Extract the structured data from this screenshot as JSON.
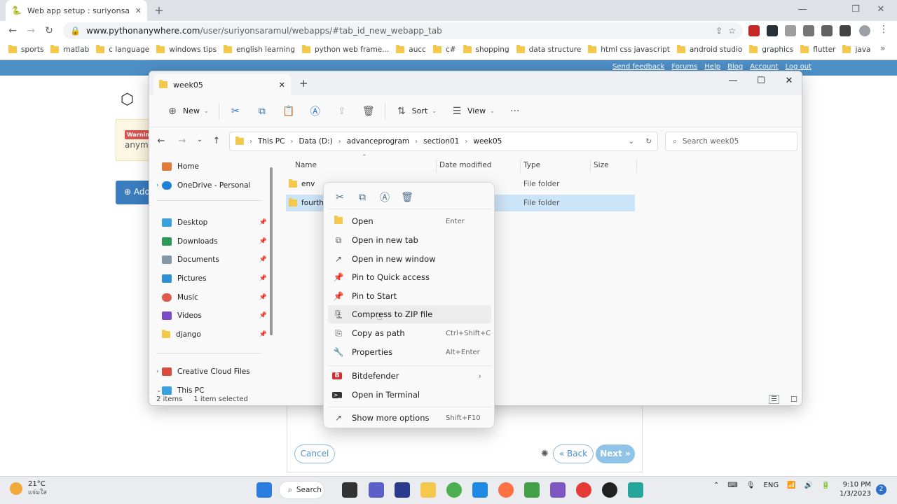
{
  "browser": {
    "tab_title": "Web app setup : suriyonsaramul",
    "url_host": "www.pythonanywhere.com",
    "url_path": "/user/suriyonsaramul/webapps/#tab_id_new_webapp_tab",
    "bookmarks": [
      "sports",
      "matlab",
      "c language",
      "windows tips",
      "english learning",
      "python web frame...",
      "aucc",
      "c#",
      "shopping",
      "data structure",
      "html css javascript",
      "android studio",
      "graphics",
      "flutter",
      "java"
    ]
  },
  "page": {
    "links": [
      "Send feedback",
      "Forums",
      "Help",
      "Blog",
      "Account",
      "Log out"
    ],
    "warning_badge": "Warnin",
    "warning_text": "anymo",
    "add_label": "Add",
    "cancel": "Cancel",
    "back": "« Back",
    "next": "Next »"
  },
  "explorer": {
    "tab_title": "week05",
    "commands": {
      "new": "New",
      "sort": "Sort",
      "view": "View"
    },
    "breadcrumb": [
      "This PC",
      "Data (D:)",
      "advanceprogram",
      "section01",
      "week05"
    ],
    "search_placeholder": "Search week05",
    "sidebar": {
      "home": "Home",
      "onedrive": "OneDrive - Personal",
      "pinned": [
        "Desktop",
        "Downloads",
        "Documents",
        "Pictures",
        "Music",
        "Videos",
        "django"
      ],
      "creative_cloud": "Creative Cloud Files",
      "this_pc": "This PC"
    },
    "columns": [
      "Name",
      "Date modified",
      "Type",
      "Size"
    ],
    "files": [
      {
        "name": "env",
        "type": "File folder"
      },
      {
        "name": "fourth_c",
        "type": "File folder"
      }
    ],
    "status_items": "2 items",
    "status_selected": "1 item selected"
  },
  "context_menu": {
    "items": [
      {
        "label": "Open",
        "shortcut": "Enter",
        "icon": "folder-open-icon"
      },
      {
        "label": "Open in new tab",
        "shortcut": "",
        "icon": "new-tab-icon"
      },
      {
        "label": "Open in new window",
        "shortcut": "",
        "icon": "new-window-icon"
      },
      {
        "label": "Pin to Quick access",
        "shortcut": "",
        "icon": "pin-icon"
      },
      {
        "label": "Pin to Start",
        "shortcut": "",
        "icon": "pin-icon"
      },
      {
        "label": "Compress to ZIP file",
        "shortcut": "",
        "icon": "zip-icon"
      },
      {
        "label": "Copy as path",
        "shortcut": "Ctrl+Shift+C",
        "icon": "copy-path-icon"
      },
      {
        "label": "Properties",
        "shortcut": "Alt+Enter",
        "icon": "wrench-icon"
      }
    ],
    "bitdefender": "Bitdefender",
    "terminal": "Open in Terminal",
    "more": "Show more options",
    "more_shortcut": "Shift+F10"
  },
  "taskbar": {
    "temp": "21°C",
    "weather_sub": "แจ่มใส",
    "search": "Search",
    "lang": "ENG",
    "time": "9:10 PM",
    "date": "1/3/2023",
    "notifications": "2"
  }
}
